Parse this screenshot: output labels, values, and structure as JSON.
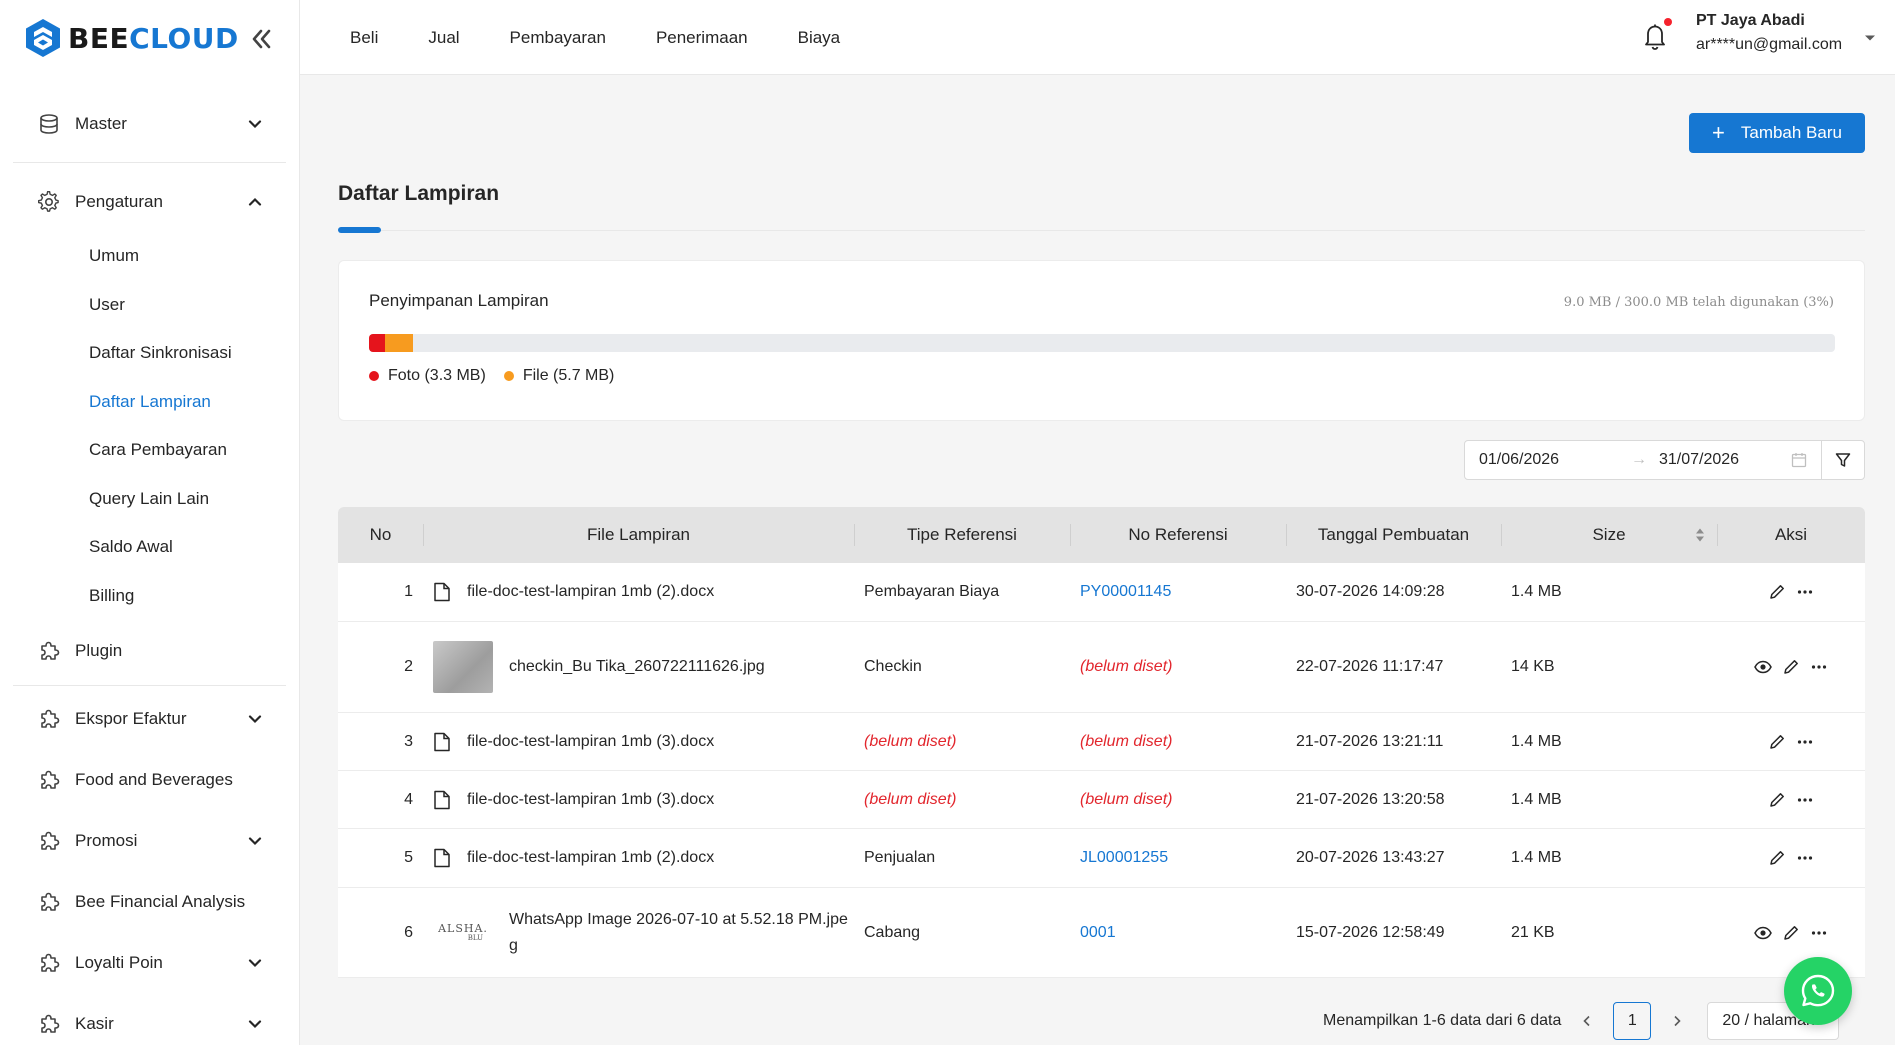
{
  "brand": {
    "part1": "BEE",
    "part2": "CLOUD"
  },
  "sidebar": {
    "master": "Master",
    "pengaturan": "Pengaturan",
    "pengaturan_items": [
      "Umum",
      "User",
      "Daftar Sinkronisasi",
      "Daftar Lampiran",
      "Cara Pembayaran",
      "Query Lain Lain",
      "Saldo Awal",
      "Billing"
    ],
    "plugin": "Plugin",
    "plugins": [
      "Ekspor Efaktur",
      "Food and Beverages",
      "Promosi",
      "Bee Financial Analysis",
      "Loyalti Poin",
      "Kasir"
    ]
  },
  "topnav": [
    "Beli",
    "Jual",
    "Pembayaran",
    "Penerimaan",
    "Biaya"
  ],
  "user": {
    "company": "PT Jaya Abadi",
    "email": "ar****un@gmail.com"
  },
  "main": {
    "add_button": "Tambah Baru",
    "title": "Daftar Lampiran"
  },
  "storage": {
    "title": "Penyimpanan Lampiran",
    "usage": "9.0 MB / 300.0 MB telah digunakan (3%)",
    "foto_label": "Foto (3.3 MB)",
    "file_label": "File (5.7 MB)",
    "foto_fraction": 0.011,
    "file_fraction": 0.019,
    "foto_color": "#e5141c",
    "file_color": "#f79b1f"
  },
  "filter": {
    "start": "01/06/2026",
    "end": "31/07/2026",
    "arrow": "→"
  },
  "table": {
    "headers": {
      "no": "No",
      "file": "File Lampiran",
      "tipe": "Tipe Referensi",
      "noref": "No Referensi",
      "tgl": "Tanggal Pembuatan",
      "size": "Size",
      "aksi": "Aksi"
    },
    "rows": [
      {
        "no": "1",
        "file": "file-doc-test-lampiran 1mb (2).docx",
        "tipe": "Pembayaran Biaya",
        "noref": "PY00001145",
        "tgl": "30-07-2026 14:09:28",
        "size": "1.4 MB"
      },
      {
        "no": "2",
        "file": "checkin_Bu Tika_260722111626.jpg",
        "tipe": "Checkin",
        "noref": "(belum diset)",
        "tgl": "22-07-2026 11:17:47",
        "size": "14 KB"
      },
      {
        "no": "3",
        "file": "file-doc-test-lampiran 1mb (3).docx",
        "tipe": "(belum diset)",
        "noref": "(belum diset)",
        "tgl": "21-07-2026 13:21:11",
        "size": "1.4 MB"
      },
      {
        "no": "4",
        "file": "file-doc-test-lampiran 1mb (3).docx",
        "tipe": "(belum diset)",
        "noref": "(belum diset)",
        "tgl": "21-07-2026 13:20:58",
        "size": "1.4 MB"
      },
      {
        "no": "5",
        "file": "file-doc-test-lampiran 1mb (2).docx",
        "tipe": "Penjualan",
        "noref": "JL00001255",
        "tgl": "20-07-2026 13:43:27",
        "size": "1.4 MB"
      },
      {
        "no": "6",
        "file": "WhatsApp Image 2026-07-10 at 5.52.18 PM.jpeg",
        "tipe": "Cabang",
        "noref": "0001",
        "tgl": "15-07-2026 12:58:49",
        "size": "21 KB"
      }
    ],
    "thumb_logo": {
      "line1": "ALSHA.",
      "line2": "BLU"
    }
  },
  "pagination": {
    "summary": "Menampilkan 1-6 data dari 6 data",
    "page": "1",
    "page_size": "20 / halaman"
  },
  "colors": {
    "accent": "#1677d2",
    "danger": "#e2262d",
    "whatsapp": "#25d366"
  }
}
